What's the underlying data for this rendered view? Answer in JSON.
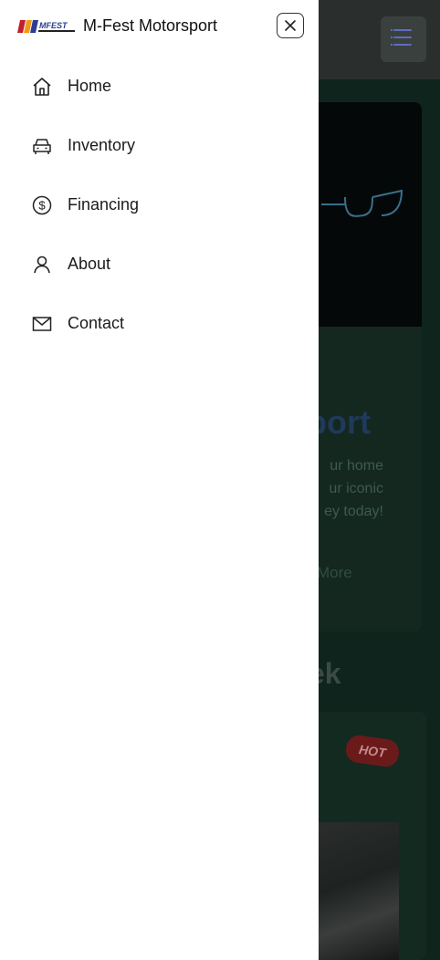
{
  "brand": {
    "logo_text": "MFEST",
    "name": "M-Fest Motorsport"
  },
  "drawer": {
    "close_icon": "close-icon",
    "items": [
      {
        "label": "Home",
        "icon": "home-icon"
      },
      {
        "label": "Inventory",
        "icon": "car-icon"
      },
      {
        "label": "Financing",
        "icon": "dollar-icon"
      },
      {
        "label": "About",
        "icon": "user-icon"
      },
      {
        "label": "Contact",
        "icon": "mail-icon"
      }
    ]
  },
  "background_page": {
    "hero_title_fragment": "port",
    "hero_text_lines": [
      "ur home",
      "ur iconic",
      "ey today!"
    ],
    "hero_link_fragment": "More",
    "section_title_fragment": "ek",
    "badge": "HOT"
  },
  "colors": {
    "drawer_bg": "#ffffff",
    "overlay_bg": "#0f241c",
    "text": "#1b1b1b",
    "badge_bg": "#6b1a1a"
  }
}
